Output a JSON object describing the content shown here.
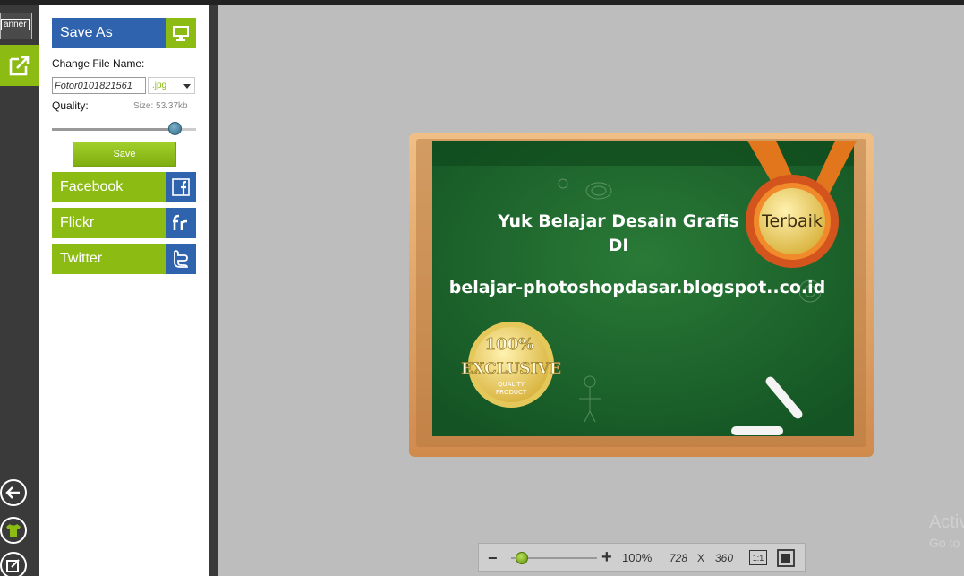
{
  "rail": {
    "banner_label": "anner",
    "items": [
      "export-icon",
      "back-arrow-icon",
      "tshirt-icon",
      "edit-icon"
    ]
  },
  "panel": {
    "save_as_label": "Save As",
    "change_file_name_label": "Change File Name:",
    "file_name": "Fotor0101821561",
    "extension": ".jpg",
    "quality_label": "Quality:",
    "size_label": "Size:",
    "size_value": "53.37kb",
    "quality_percent": 85,
    "save_button": "Save",
    "share": [
      {
        "label": "Facebook",
        "icon": "facebook-icon"
      },
      {
        "label": "Flickr",
        "icon": "flickr-icon"
      },
      {
        "label": "Twitter",
        "icon": "twitter-icon"
      }
    ]
  },
  "board": {
    "line1": "Yuk Belajar Desain Grafis",
    "line2": "DI",
    "line3": "belajar-photoshopdasar.blogspot..co.id",
    "medal_text": "Terbaik",
    "badge_top": "100%",
    "badge_mid": "EXCLUSIVE",
    "badge_sub1": "QUALITY",
    "badge_sub2": "PRODUCT"
  },
  "zoombar": {
    "minus": "−",
    "plus": "+",
    "zoom": "100%",
    "zoom_fraction": 0.13,
    "width": "728",
    "x": "X",
    "height": "360",
    "actual_size": "1:1"
  },
  "watermark": {
    "line1": "Activ",
    "line2": "Go to"
  },
  "colors": {
    "accent_green": "#8cbc14",
    "accent_blue": "#2f63ad",
    "board_green": "#1f6b2f",
    "frame_wood": "#e2a66a"
  }
}
